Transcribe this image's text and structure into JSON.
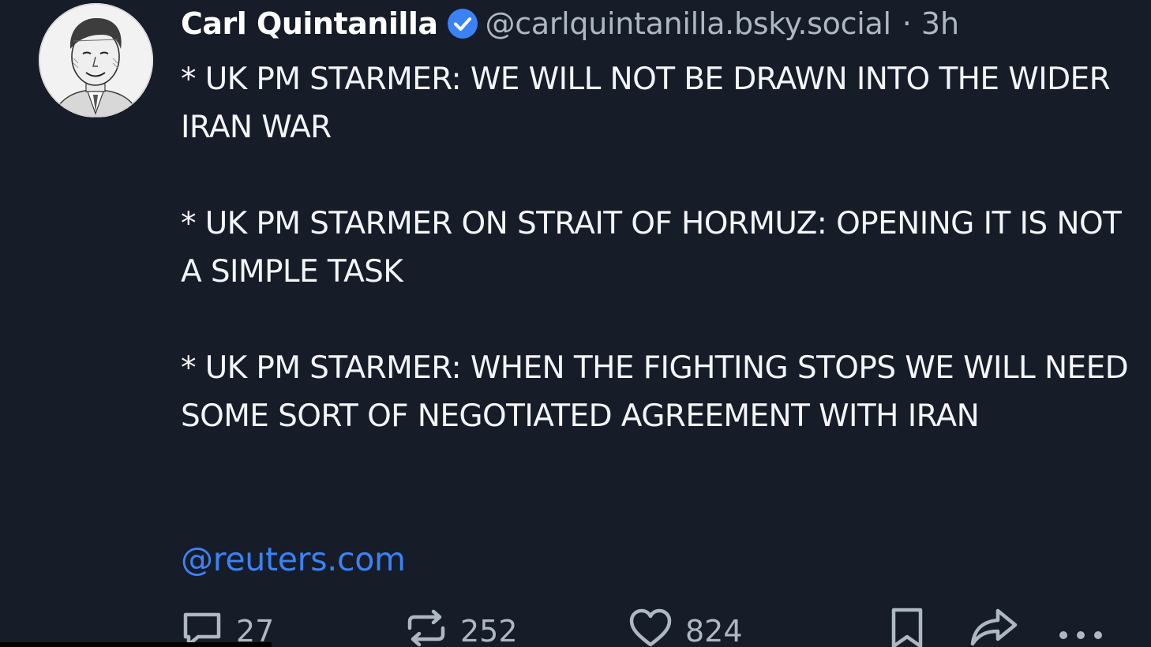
{
  "author": {
    "display_name": "Carl Quintanilla",
    "handle": "@carlquintanilla.bsky.social",
    "separator": "·",
    "time_ago": "3h",
    "verified_icon": "verified-check-icon",
    "avatar": "portrait-avatar"
  },
  "post": {
    "paragraphs": [
      "* UK PM STARMER: WE WILL NOT BE DRAWN INTO THE WIDER IRAN WAR",
      "* UK PM STARMER ON STRAIT OF HORMUZ:  OPENING IT IS NOT A SIMPLE TASK",
      "* UK PM STARMER: WHEN THE FIGHTING STOPS WE WILL NEED SOME SORT OF NEGOTIATED AGREEMENT WITH IRAN"
    ],
    "link": "@reuters.com"
  },
  "actions": {
    "reply": {
      "icon": "reply-icon",
      "count": "27"
    },
    "repost": {
      "icon": "repost-icon",
      "count": "252"
    },
    "like": {
      "icon": "heart-icon",
      "count": "824"
    },
    "bookmark": {
      "icon": "bookmark-icon"
    },
    "share": {
      "icon": "share-icon"
    },
    "more": {
      "icon": "more-options-icon"
    }
  },
  "colors": {
    "background": "#161c28",
    "text": "#f3f5f8",
    "muted": "#aeb7c4",
    "link": "#3b82f6",
    "verified": "#3b82f6"
  }
}
